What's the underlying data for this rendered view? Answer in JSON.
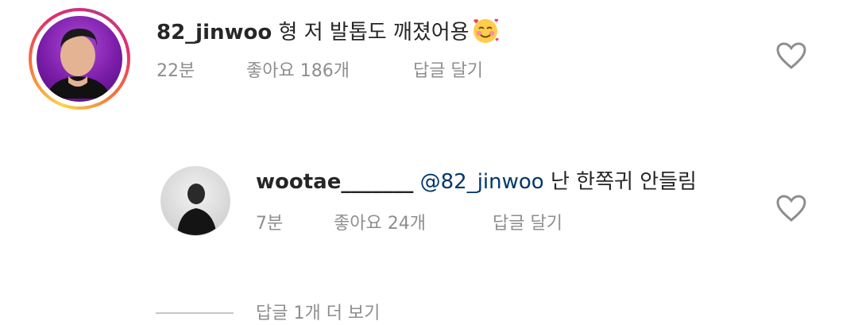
{
  "comments": [
    {
      "username": "82_jinwoo",
      "text": " 형 저 발톱도 깨졌어용",
      "emoji_icon": "smiling-face-with-hearts-icon",
      "time": "22분",
      "likes": "좋아요 186개",
      "reply_label": "답글 달기"
    }
  ],
  "replies": [
    {
      "username": "wootae_______",
      "mention": " @82_jinwoo",
      "text": " 난 한쪽귀 안들림",
      "time": "7분",
      "likes": "좋아요 24개",
      "reply_label": "답글 달기"
    }
  ],
  "view_more_replies": "답글 1개 더 보기",
  "colors": {
    "username": "#262626",
    "meta": "#8e8e8e",
    "mention": "#00376b",
    "heart_outline": "#8e8e8e"
  }
}
